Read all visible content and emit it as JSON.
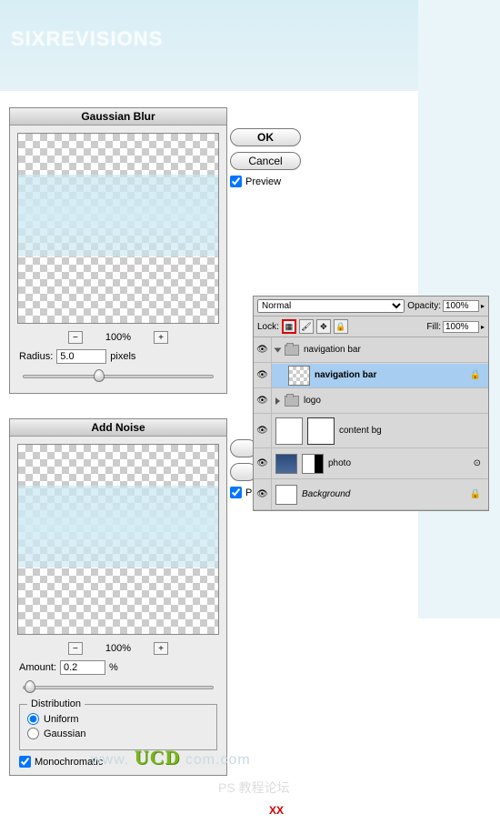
{
  "header": {
    "brand": "SIXREVISIONS"
  },
  "gaussian": {
    "title": "Gaussian Blur",
    "zoom": "100%",
    "radius_label": "Radius:",
    "radius_value": "5.0",
    "radius_unit": "pixels",
    "ok": "OK",
    "cancel": "Cancel",
    "preview": "Preview"
  },
  "noise": {
    "title": "Add Noise",
    "zoom": "100%",
    "amount_label": "Amount:",
    "amount_value": "0.2",
    "amount_unit": "%",
    "distribution_label": "Distribution",
    "uniform": "Uniform",
    "gaussian": "Gaussian",
    "mono": "Monochromatic",
    "preview_partial": "Pre"
  },
  "layers": {
    "blend": "Normal",
    "opacity_label": "Opacity:",
    "opacity_value": "100%",
    "lock_label": "Lock:",
    "fill_label": "Fill:",
    "fill_value": "100%",
    "items": [
      {
        "name": "navigation bar"
      },
      {
        "name": "navigation bar"
      },
      {
        "name": "logo"
      },
      {
        "name": "content bg"
      },
      {
        "name": "photo"
      },
      {
        "name": "Background"
      }
    ]
  },
  "watermark": {
    "prefix": "www.",
    "brand": "UCD",
    "suffix": "com.com"
  },
  "footer": {
    "ps": "PS 教程论坛",
    "xx": "XX"
  }
}
